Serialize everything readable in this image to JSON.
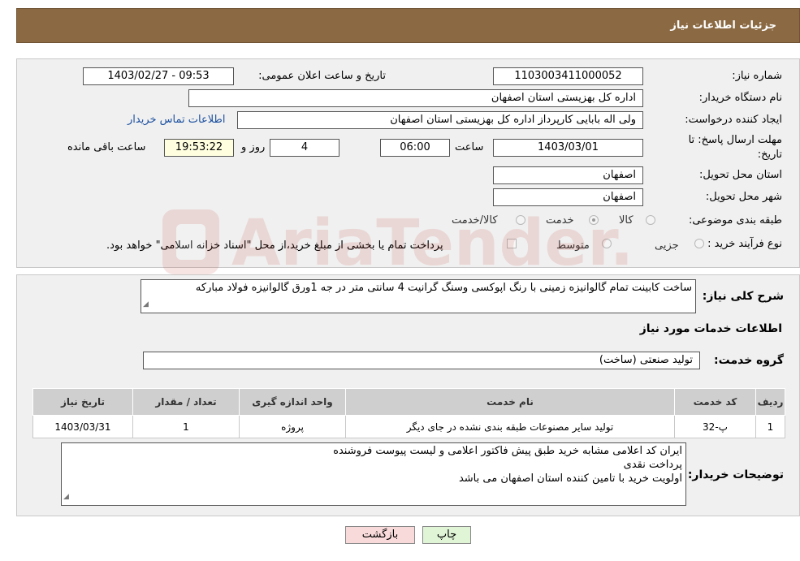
{
  "header": {
    "title": "جزئیات اطلاعات نیاز"
  },
  "info": {
    "need_number": {
      "label": "شماره نیاز:",
      "value": "1103003411000052"
    },
    "announce": {
      "label": "تاریخ و ساعت اعلان عمومی:",
      "value": "1403/02/27 - 09:53"
    },
    "buyer_org": {
      "label": "نام دستگاه خریدار:",
      "value": "اداره کل بهزیستی استان اصفهان"
    },
    "creator": {
      "label": "ایجاد کننده درخواست:",
      "value": "ولی اله بابایی کارپرداز اداره کل بهزیستی استان اصفهان",
      "contact_link": "اطلاعات تماس خریدار"
    },
    "deadline": {
      "label_line1": "مهلت ارسال پاسخ: تا",
      "label_line2": "تاریخ:",
      "date": "1403/03/01",
      "time_label": "ساعت",
      "time": "06:00",
      "days": "4",
      "days_label": "روز و",
      "remaining": "19:53:22",
      "remaining_label": "ساعت باقی مانده"
    },
    "province": {
      "label": "استان محل تحویل:",
      "value": "اصفهان"
    },
    "city": {
      "label": "شهر محل تحویل:",
      "value": "اصفهان"
    },
    "category": {
      "label": "طبقه بندی موضوعی:",
      "options": [
        {
          "label": "کالا",
          "checked": false
        },
        {
          "label": "خدمت",
          "checked": true
        },
        {
          "label": "کالا/خدمت",
          "checked": false
        }
      ]
    },
    "purchase_type": {
      "label": "نوع فرآیند خرید :",
      "options": [
        {
          "label": "جزیی",
          "checked": false
        },
        {
          "label": "متوسط",
          "checked": false
        }
      ],
      "payment_note": "پرداخت تمام یا بخشی از مبلغ خرید،از محل \"اسناد خزانه اسلامی\" خواهد بود."
    }
  },
  "details": {
    "summary_label": "شرح کلی نیاز:",
    "summary_value": "ساخت کابینت تمام گالوانیزه زمینی با رنگ اپوکسی وسنگ گرانیت 4 سانتی متر در جه 1ورق گالوانیزه فولاد مبارکه",
    "services_title": "اطلاعات خدمات مورد نیاز",
    "service_group_label": "گروه خدمت:",
    "service_group_value": "تولید صنعتی (ساخت)",
    "table": {
      "headers": [
        "ردیف",
        "کد خدمت",
        "نام خدمت",
        "واحد اندازه گیری",
        "تعداد / مقدار",
        "تاریخ نیاز"
      ],
      "rows": [
        [
          "1",
          "پ-32",
          "تولید سایر مصنوعات طبقه بندی نشده در جای دیگر",
          "پروژه",
          "1",
          "1403/03/31"
        ]
      ]
    },
    "buyer_notes_label": "توضیحات خریدار:",
    "buyer_notes": [
      "ایران کد اعلامی مشابه خرید طبق پیش فاکتور اعلامی و لیست پیوست  فروشنده",
      "پرداخت نقدی",
      "اولویت خرید با تامین کننده استان اصفهان  می باشد"
    ]
  },
  "buttons": {
    "print": "چاپ",
    "back": "بازگشت"
  },
  "watermark": {
    "text": "AriaTender.neT"
  }
}
